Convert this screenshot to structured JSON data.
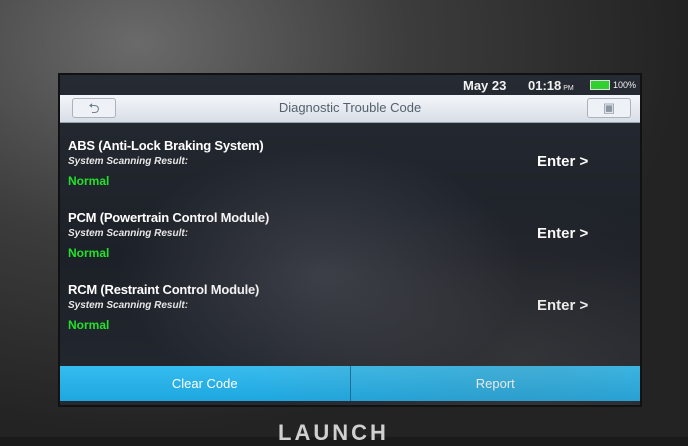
{
  "status_bar": {
    "date": "May 23",
    "time": "01:18",
    "ampm": "PM",
    "battery": "100%",
    "battery_color": "#2fd12f"
  },
  "header": {
    "title": "Diagnostic Trouble Code",
    "back_icon": "back-arrow-icon",
    "exit_icon": "exit-door-icon"
  },
  "modules": [
    {
      "name": "ABS (Anti-Lock Braking System)",
      "scan_label": "System Scanning Result:",
      "status": "Normal",
      "enter_label": "Enter >"
    },
    {
      "name": "PCM (Powertrain Control Module)",
      "scan_label": "System Scanning Result:",
      "status": "Normal",
      "enter_label": "Enter >"
    },
    {
      "name": "RCM (Restraint Control Module)",
      "scan_label": "System Scanning Result:",
      "status": "Normal",
      "enter_label": "Enter >"
    }
  ],
  "actions": {
    "clear_code": "Clear Code",
    "report": "Report"
  },
  "brand": "LAUNCH",
  "colors": {
    "accent": "#1ea6df",
    "normal_status": "#22e12a"
  }
}
